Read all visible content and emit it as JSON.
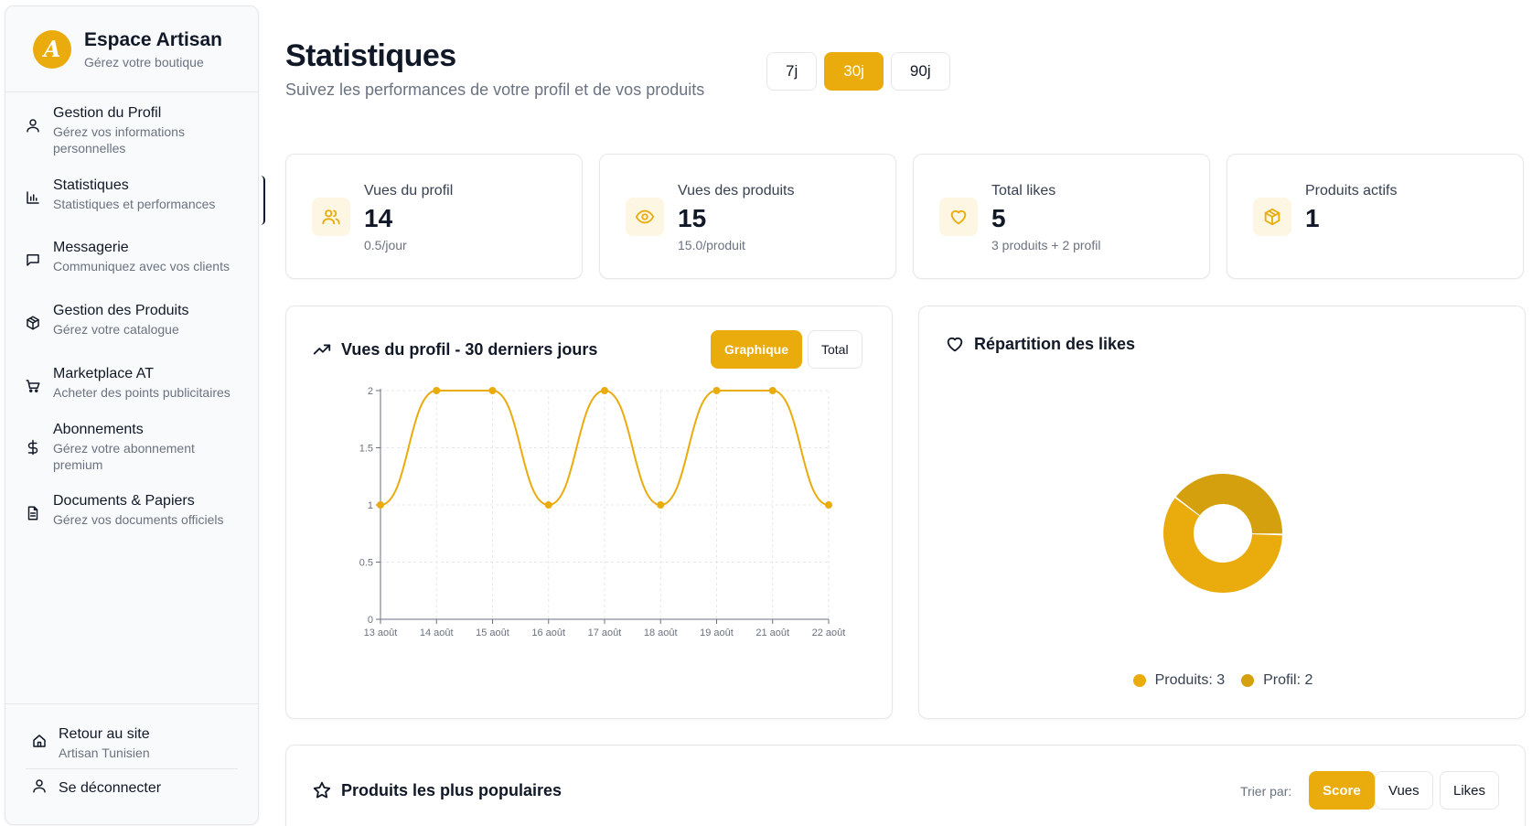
{
  "brand": {
    "title": "Espace Artisan",
    "subtitle": "Gérez votre boutique",
    "logo_letter": "A"
  },
  "sidebar": {
    "items": [
      {
        "label": "Gestion du Profil",
        "desc": "Gérez vos informations personnelles",
        "icon": "user-icon"
      },
      {
        "label": "Statistiques",
        "desc": "Statistiques et performances",
        "icon": "bar-chart-icon",
        "active": true
      },
      {
        "label": "Messagerie",
        "desc": "Communiquez avec vos clients",
        "icon": "message-icon"
      },
      {
        "label": "Gestion des Produits",
        "desc": "Gérez votre catalogue",
        "icon": "package-icon"
      },
      {
        "label": "Marketplace AT",
        "desc": "Acheter des points publicitaires",
        "icon": "cart-icon"
      },
      {
        "label": "Abonnements",
        "desc": "Gérez votre abonnement premium",
        "icon": "dollar-icon"
      },
      {
        "label": "Documents & Papiers",
        "desc": "Gérez vos documents officiels",
        "icon": "document-icon"
      }
    ],
    "footer": {
      "back_label": "Retour au site",
      "back_desc": "Artisan Tunisien",
      "logout_label": "Se déconnecter"
    }
  },
  "header": {
    "title": "Statistiques",
    "subtitle": "Suivez les performances de votre profil et de vos produits",
    "periods": [
      "7j",
      "30j",
      "90j"
    ],
    "active_period": "30j"
  },
  "stats": [
    {
      "label": "Vues du profil",
      "value": "14",
      "sub": "0.5/jour",
      "icon": "users-icon"
    },
    {
      "label": "Vues des produits",
      "value": "15",
      "sub": "15.0/produit",
      "icon": "eye-icon"
    },
    {
      "label": "Total likes",
      "value": "5",
      "sub": "3 produits + 2 profil",
      "icon": "heart-icon"
    },
    {
      "label": "Produits actifs",
      "value": "1",
      "sub": "",
      "icon": "package-icon"
    }
  ],
  "views_chart": {
    "title": "Vues du profil - 30 derniers jours",
    "toggle": [
      "Graphique",
      "Total"
    ],
    "active_toggle": "Graphique"
  },
  "likes_chart": {
    "title": "Répartition des likes",
    "legend": [
      {
        "label": "Produits: 3",
        "color": "#eaab0c"
      },
      {
        "label": "Profil: 2",
        "color": "#d4a00e"
      }
    ]
  },
  "popular": {
    "title": "Produits les plus populaires",
    "sort_label": "Trier par:",
    "sort_options": [
      "Score",
      "Vues",
      "Likes"
    ],
    "active_sort": "Score"
  },
  "chart_data": [
    {
      "type": "line",
      "x": [
        "13 août",
        "14 août",
        "15 août",
        "16 août",
        "17 août",
        "18 août",
        "19 août",
        "21 août",
        "22 août"
      ],
      "series": [
        {
          "values": [
            1,
            2,
            2,
            1,
            2,
            1,
            2,
            2,
            1
          ]
        }
      ],
      "yticks": [
        "0",
        "0.5",
        "1",
        "1.5",
        "2"
      ],
      "ylim": [
        0,
        2
      ],
      "grid": true,
      "color": "#eaab0c"
    },
    {
      "type": "pie",
      "labels": [
        "Produits",
        "Profil"
      ],
      "values": [
        3,
        2
      ],
      "colors": [
        "#eaab0c",
        "#d4a00e"
      ],
      "donut": true
    }
  ]
}
